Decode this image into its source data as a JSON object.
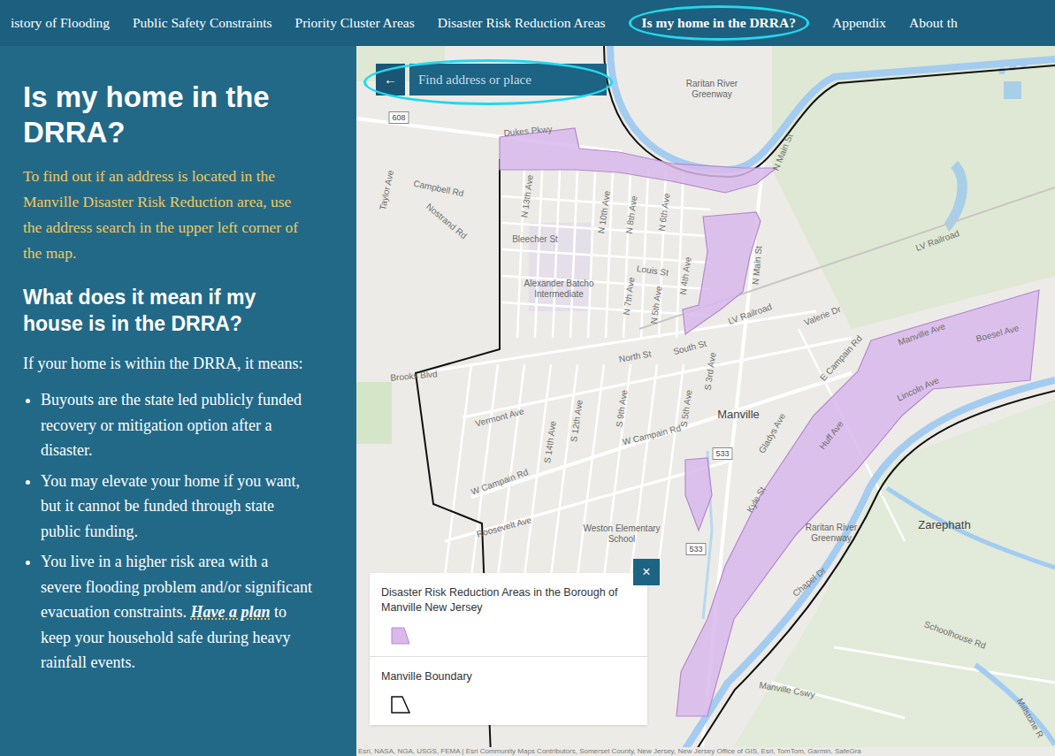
{
  "nav": {
    "items": [
      {
        "label": "istory of Flooding",
        "selected": false,
        "circled": false
      },
      {
        "label": "Public Safety Constraints",
        "selected": false,
        "circled": false
      },
      {
        "label": "Priority Cluster Areas",
        "selected": false,
        "circled": false
      },
      {
        "label": "Disaster Risk Reduction Areas",
        "selected": false,
        "circled": false
      },
      {
        "label": "Is my home in the DRRA?",
        "selected": true,
        "circled": true
      },
      {
        "label": "Appendix",
        "selected": false,
        "circled": false
      },
      {
        "label": "About th",
        "selected": false,
        "circled": false
      }
    ]
  },
  "panel": {
    "title": "Is my home in the DRRA?",
    "intro": "To find out if an address is located in the Manville Disaster Risk Reduction area, use the address search in the upper left corner of the map.",
    "subtitle": "What does it mean if my house is in the DRRA?",
    "lead": "If your home is within the DRRA, it means:",
    "bullets": [
      {
        "text": "Buyouts are the state led publicly funded recovery or mitigation option after a disaster.",
        "link": "",
        "after": ""
      },
      {
        "text": "You may elevate your home if you want, but it cannot be funded through state public funding.",
        "link": "",
        "after": ""
      },
      {
        "text": "You live in a higher risk area with a severe flooding problem and/or significant evacuation constraints.",
        "link": "Have a plan",
        "after": " to keep your household safe during heavy rainfall events."
      }
    ]
  },
  "map": {
    "search": {
      "back": "←",
      "placeholder": "Find address or place",
      "circled": true
    },
    "labels": [
      {
        "text": "Raritan River Greenway",
        "kind": "poi"
      },
      {
        "text": "Dukes Pkwy",
        "kind": "street"
      },
      {
        "text": "Campbell Rd",
        "kind": "street"
      },
      {
        "text": "Nostrand Rd",
        "kind": "street"
      },
      {
        "text": "Taylor Ave",
        "kind": "street"
      },
      {
        "text": "Bleecher St",
        "kind": "street"
      },
      {
        "text": "N 13th Ave",
        "kind": "street"
      },
      {
        "text": "N 10th Ave",
        "kind": "street"
      },
      {
        "text": "N 8th Ave",
        "kind": "street"
      },
      {
        "text": "N 6th Ave",
        "kind": "street"
      },
      {
        "text": "Louis St",
        "kind": "street"
      },
      {
        "text": "Alexander Batcho Intermediate",
        "kind": "poi"
      },
      {
        "text": "N 7th Ave",
        "kind": "street"
      },
      {
        "text": "N 5th Ave",
        "kind": "street"
      },
      {
        "text": "N 4th Ave",
        "kind": "street"
      },
      {
        "text": "N Main St",
        "kind": "street"
      },
      {
        "text": "N Main St",
        "kind": "street"
      },
      {
        "text": "LV Railroad",
        "kind": "street"
      },
      {
        "text": "LV Railroad",
        "kind": "street"
      },
      {
        "text": "Valerie Dr",
        "kind": "street"
      },
      {
        "text": "North St",
        "kind": "street"
      },
      {
        "text": "South St",
        "kind": "street"
      },
      {
        "text": "S 3rd Ave",
        "kind": "street"
      },
      {
        "text": "Brooks Blvd",
        "kind": "street"
      },
      {
        "text": "Vermont Ave",
        "kind": "street"
      },
      {
        "text": "S 12th Ave",
        "kind": "street"
      },
      {
        "text": "S 9th Ave",
        "kind": "street"
      },
      {
        "text": "S 5th Ave",
        "kind": "street"
      },
      {
        "text": "S 14th Ave",
        "kind": "street"
      },
      {
        "text": "Manville",
        "kind": "place"
      },
      {
        "text": "W Campain Rd",
        "kind": "street"
      },
      {
        "text": "E Campain Rd",
        "kind": "street"
      },
      {
        "text": "Gladys Ave",
        "kind": "street"
      },
      {
        "text": "W Campain Rd",
        "kind": "street"
      },
      {
        "text": "Roosevelt Ave",
        "kind": "street"
      },
      {
        "text": "Weston Elementary School",
        "kind": "poi"
      },
      {
        "text": "Manville Ave",
        "kind": "street"
      },
      {
        "text": "Boesel Ave",
        "kind": "street"
      },
      {
        "text": "Lincoln Ave",
        "kind": "street"
      },
      {
        "text": "Huff Ave",
        "kind": "street"
      },
      {
        "text": "Kyle St",
        "kind": "street"
      },
      {
        "text": "Raritan River Greenway",
        "kind": "poi"
      },
      {
        "text": "Zarephath",
        "kind": "place"
      },
      {
        "text": "Chapel Dr",
        "kind": "street"
      },
      {
        "text": "Schoolhouse Rd",
        "kind": "street"
      },
      {
        "text": "Manville Cswy",
        "kind": "street"
      },
      {
        "text": "Millstone R",
        "kind": "street"
      }
    ],
    "shields": [
      "608",
      "533",
      "533"
    ],
    "legend": {
      "close": "×",
      "items": [
        {
          "label": "Disaster Risk Reduction Areas in the Borough of Manville New Jersey",
          "kind": "fill"
        },
        {
          "label": "Manville Boundary",
          "kind": "outline"
        }
      ]
    },
    "attribution": "Esri, NASA, NGA, USGS, FEMA | Esri Community Maps Contributors, Somerset County, New Jersey, New Jersey Office of GIS, Esri, TomTom, Garmin, SafeGra"
  }
}
